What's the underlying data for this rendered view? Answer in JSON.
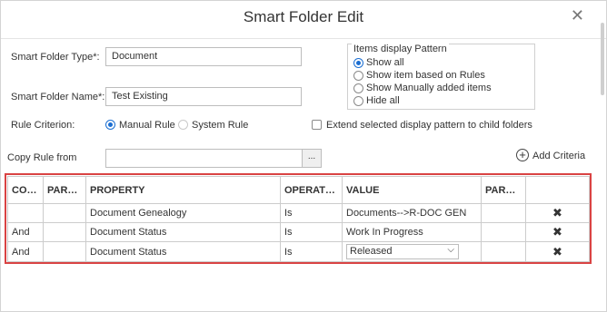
{
  "dialog": {
    "title": "Smart Folder Edit",
    "close_icon": "close-icon"
  },
  "form": {
    "type_label": "Smart Folder Type*:",
    "type_value": "Document",
    "name_label": "Smart Folder Name*:",
    "name_value": "Test Existing",
    "rule_label": "Rule Criterion:",
    "manual_rule": "Manual Rule",
    "system_rule": "System Rule",
    "manual_rule_selected": true,
    "extend_label": "Extend selected display pattern to child folders",
    "extend_checked": false,
    "copy_label": "Copy Rule from",
    "copy_value": "",
    "ellipsis_label": "...",
    "add_criteria": "Add Criteria"
  },
  "display_pattern": {
    "legend": "Items display Pattern",
    "options": [
      {
        "label": "Show all",
        "selected": true
      },
      {
        "label": "Show item based on Rules",
        "selected": false
      },
      {
        "label": "Show Manually added items",
        "selected": false
      },
      {
        "label": "Hide all",
        "selected": false
      }
    ]
  },
  "grid": {
    "columns": [
      "CON...",
      "PAREN...",
      "PROPERTY",
      "OPERATOR",
      "VALUE",
      "PAREN...",
      ""
    ],
    "rows": [
      {
        "con": "",
        "paren1": "",
        "property": "Document Genealogy",
        "operator": "Is",
        "value": "Documents-->R-DOC GEN",
        "paren2": "",
        "delete_icon": "✖"
      },
      {
        "con": "And",
        "paren1": "",
        "property": "Document Status",
        "operator": "Is",
        "value": "Work In Progress",
        "paren2": "",
        "delete_icon": "✖"
      },
      {
        "con": "And",
        "paren1": "",
        "property": "Document Status",
        "operator": "Is",
        "value": "Released",
        "paren2": "",
        "delete_icon": "✖"
      }
    ]
  },
  "colors": {
    "highlight_border": "#d94343",
    "radio_accent": "#1b6ed1"
  }
}
